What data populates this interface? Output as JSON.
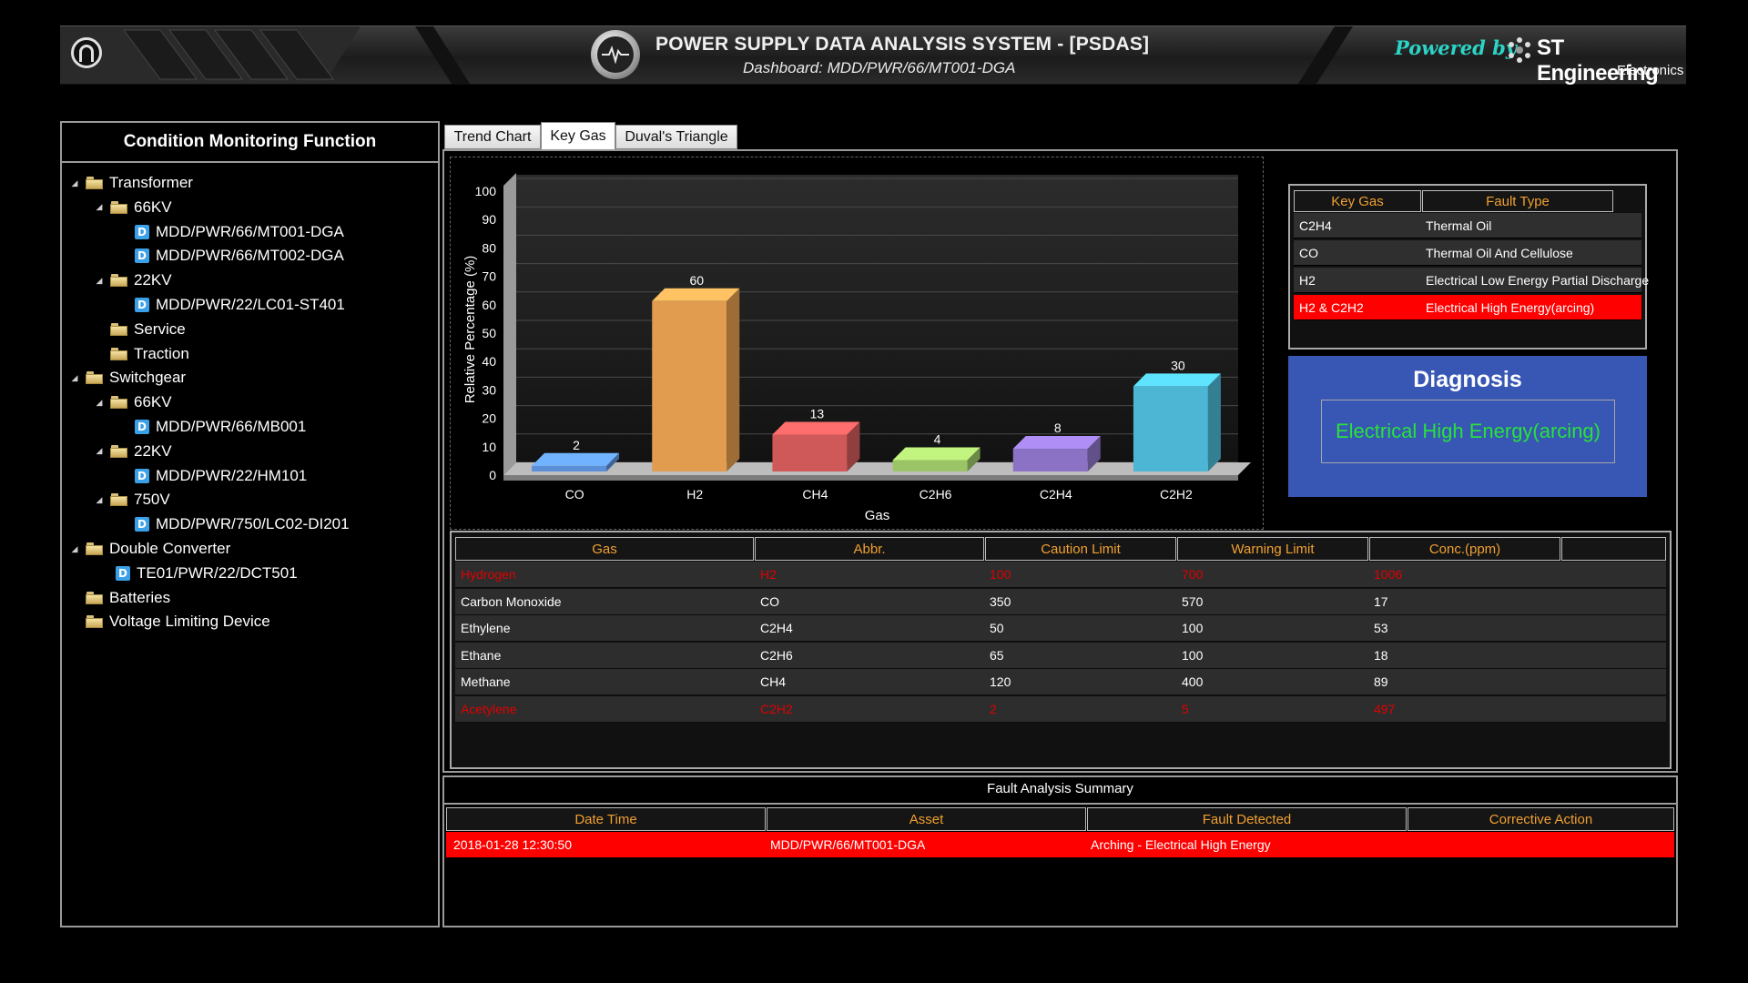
{
  "header": {
    "title": "POWER SUPPLY DATA ANALYSIS SYSTEM - [PSDAS]",
    "subtitle": "Dashboard: MDD/PWR/66/MT001-DGA",
    "powered_by": "Powered by",
    "brand_name": "ST Engineering",
    "brand_sub": "Electronics",
    "icons": [
      "power-icon",
      "heartbeat-icon",
      "st-logo-icon"
    ]
  },
  "sidebar": {
    "title": "Condition Monitoring Function",
    "tree": [
      {
        "label": "Transformer",
        "type": "folder",
        "level": 0,
        "expanded": true
      },
      {
        "label": "66KV",
        "type": "folder",
        "level": 1,
        "expanded": true
      },
      {
        "label": "MDD/PWR/66/MT001-DGA",
        "type": "doc",
        "level": 2
      },
      {
        "label": "MDD/PWR/66/MT002-DGA",
        "type": "doc",
        "level": 2
      },
      {
        "label": "22KV",
        "type": "folder",
        "level": 1,
        "expanded": true
      },
      {
        "label": "MDD/PWR/22/LC01-ST401",
        "type": "doc",
        "level": 2
      },
      {
        "label": "Service",
        "type": "folder",
        "level": 1
      },
      {
        "label": "Traction",
        "type": "folder",
        "level": 1
      },
      {
        "label": "Switchgear",
        "type": "folder",
        "level": 0,
        "expanded": true
      },
      {
        "label": "66KV",
        "type": "folder",
        "level": 1,
        "expanded": true
      },
      {
        "label": "MDD/PWR/66/MB001",
        "type": "doc",
        "level": 2
      },
      {
        "label": "22KV",
        "type": "folder",
        "level": 1,
        "expanded": true
      },
      {
        "label": "MDD/PWR/22/HM101",
        "type": "doc",
        "level": 2
      },
      {
        "label": "750V",
        "type": "folder",
        "level": 1,
        "expanded": true
      },
      {
        "label": "MDD/PWR/750/LC02-DI201",
        "type": "doc",
        "level": 2
      },
      {
        "label": "Double Converter",
        "type": "folder",
        "level": 0,
        "expanded": true
      },
      {
        "label": "TE01/PWR/22/DCT501",
        "type": "doc",
        "level": 1
      },
      {
        "label": "Batteries",
        "type": "folder",
        "level": 0
      },
      {
        "label": "Voltage Limiting Device",
        "type": "folder",
        "level": 0
      }
    ]
  },
  "tabs": [
    {
      "label": "Trend Chart",
      "active": false
    },
    {
      "label": "Key Gas",
      "active": true
    },
    {
      "label": "Duval's Triangle",
      "active": false
    }
  ],
  "chart_data": {
    "type": "bar",
    "categories": [
      "CO",
      "H2",
      "CH4",
      "C2H6",
      "C2H4",
      "C2H2"
    ],
    "values": [
      2,
      60,
      13,
      4,
      8,
      30
    ],
    "colors": [
      "#5b8fd8",
      "#e29c4f",
      "#cf5858",
      "#9bc466",
      "#8c72c4",
      "#4cb6d4"
    ],
    "xlabel": "Gas",
    "ylabel": "Relative Percentage (%)",
    "ylim": [
      0,
      100
    ],
    "yticks": [
      0,
      10,
      20,
      30,
      40,
      50,
      60,
      70,
      80,
      90,
      100
    ],
    "grid": true,
    "style": "3d-bar"
  },
  "key_gas_table": {
    "headers": [
      "Key Gas",
      "Fault Type"
    ],
    "rows": [
      {
        "gas": "C2H4",
        "fault": "Thermal Oil",
        "highlight": false
      },
      {
        "gas": "CO",
        "fault": "Thermal Oil And Cellulose",
        "highlight": false
      },
      {
        "gas": "H2",
        "fault": "Electrical Low Energy Partial Discharge",
        "highlight": false
      },
      {
        "gas": "H2 & C2H2",
        "fault": "Electrical High Energy(arcing)",
        "highlight": true
      }
    ]
  },
  "diagnosis": {
    "title": "Diagnosis",
    "value": "Electrical High Energy(arcing)"
  },
  "gas_table": {
    "headers": [
      "Gas",
      "Abbr.",
      "Caution Limit",
      "Warning Limit",
      "Conc.(ppm)"
    ],
    "rows": [
      {
        "gas": "Hydrogen",
        "abbr": "H2",
        "caution": "100",
        "warning": "700",
        "conc": "1006",
        "alert": true
      },
      {
        "gas": "Carbon Monoxide",
        "abbr": "CO",
        "caution": "350",
        "warning": "570",
        "conc": "17",
        "alert": false
      },
      {
        "gas": "Ethylene",
        "abbr": "C2H4",
        "caution": "50",
        "warning": "100",
        "conc": "53",
        "alert": false
      },
      {
        "gas": "Ethane",
        "abbr": "C2H6",
        "caution": "65",
        "warning": "100",
        "conc": "18",
        "alert": false
      },
      {
        "gas": "Methane",
        "abbr": "CH4",
        "caution": "120",
        "warning": "400",
        "conc": "89",
        "alert": false
      },
      {
        "gas": "Acetylene",
        "abbr": "C2H2",
        "caution": "2",
        "warning": "5",
        "conc": "497",
        "alert": true
      }
    ]
  },
  "fault_summary": {
    "title": "Fault Analysis Summary",
    "headers": [
      "Date Time",
      "Asset",
      "Fault Detected",
      "Corrective Action"
    ],
    "rows": [
      {
        "datetime": "2018-01-28 12:30:50",
        "asset": "MDD/PWR/66/MT001-DGA",
        "fault": "Arching - Electrical High Energy",
        "action": ""
      }
    ]
  },
  "colors": {
    "header_text": "#f0a030",
    "alert": "#ff0000",
    "diagnosis_bg": "#3856b4",
    "diagnosis_text": "#28e23c",
    "powered_by": "#2bd4c6"
  }
}
